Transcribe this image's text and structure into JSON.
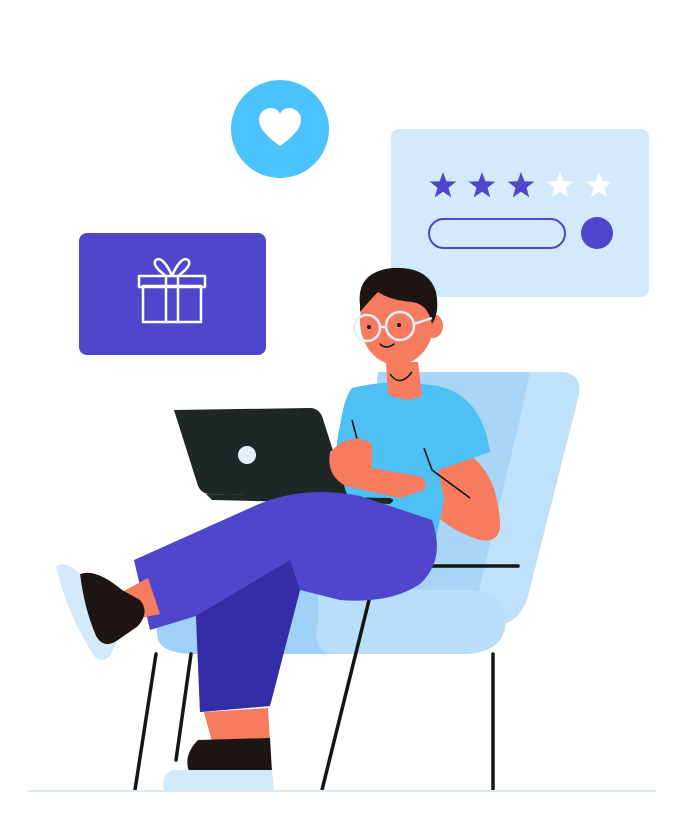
{
  "rating": {
    "filled_stars": 3,
    "total_stars": 5
  },
  "icons": {
    "heart": "heart-icon",
    "gift": "gift-icon",
    "star": "star-icon"
  },
  "colors": {
    "primary_purple": "#4F46CC",
    "heart_badge_blue": "#4CC2FF",
    "review_card_bg": "#D2EAFB",
    "chair_light": "#A9D6F7",
    "shirt_blue": "#4DC0F6",
    "skin": "#F77B5E",
    "hair": "#1C1512",
    "laptop": "#1E2726",
    "pants_purple": "#4F46CC",
    "floor_line": "#DBE9F6"
  }
}
